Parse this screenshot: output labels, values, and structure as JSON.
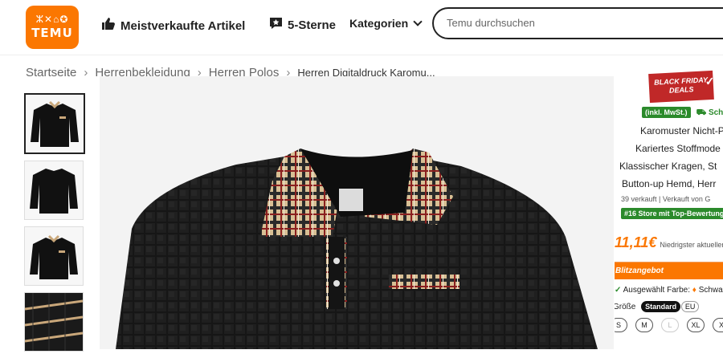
{
  "header": {
    "logo_icons": "ⵣ✕⌂✪",
    "logo_text": "TEMU",
    "nav_bestsellers": "Meistverkaufte Artikel",
    "nav_five_star": "5-Sterne",
    "nav_categories": "Kategorien",
    "search_placeholder": "Temu durchsuchen"
  },
  "breadcrumb": {
    "items": [
      "Startseite",
      "Herrenbekleidung",
      "Herren Polos",
      "Herren Digitaldruck Karomu..."
    ],
    "separator": "›"
  },
  "product": {
    "badge": "BLACK FRIDAY DEALS",
    "tax_label": "(inkl. MwSt.)",
    "shipping_label": "Schn",
    "title_lines": [
      "Karomuster Nicht-P",
      "Kariertes Stoffmode",
      "Klassischer Kragen, St",
      "Button-up Hemd, Herr"
    ],
    "sold": "39 verkauft",
    "seller": "Verkauft von G",
    "store_badge": "#16 Store mit Top-Bewertung",
    "price": "11,11€",
    "price_note": "Niedrigster aktueller P",
    "flash_title": "Blitzangebot",
    "color_label": "Ausgewählt Farbe:",
    "color_value": "Schwa",
    "size_label": "Größe",
    "size_standard": "Standard",
    "size_region": "EU",
    "sizes": [
      "S",
      "M",
      "L",
      "XL",
      "X"
    ]
  },
  "colors": {
    "brand": "#fb7701",
    "black_friday": "#c02828",
    "green_badge": "#2b8a2b"
  }
}
